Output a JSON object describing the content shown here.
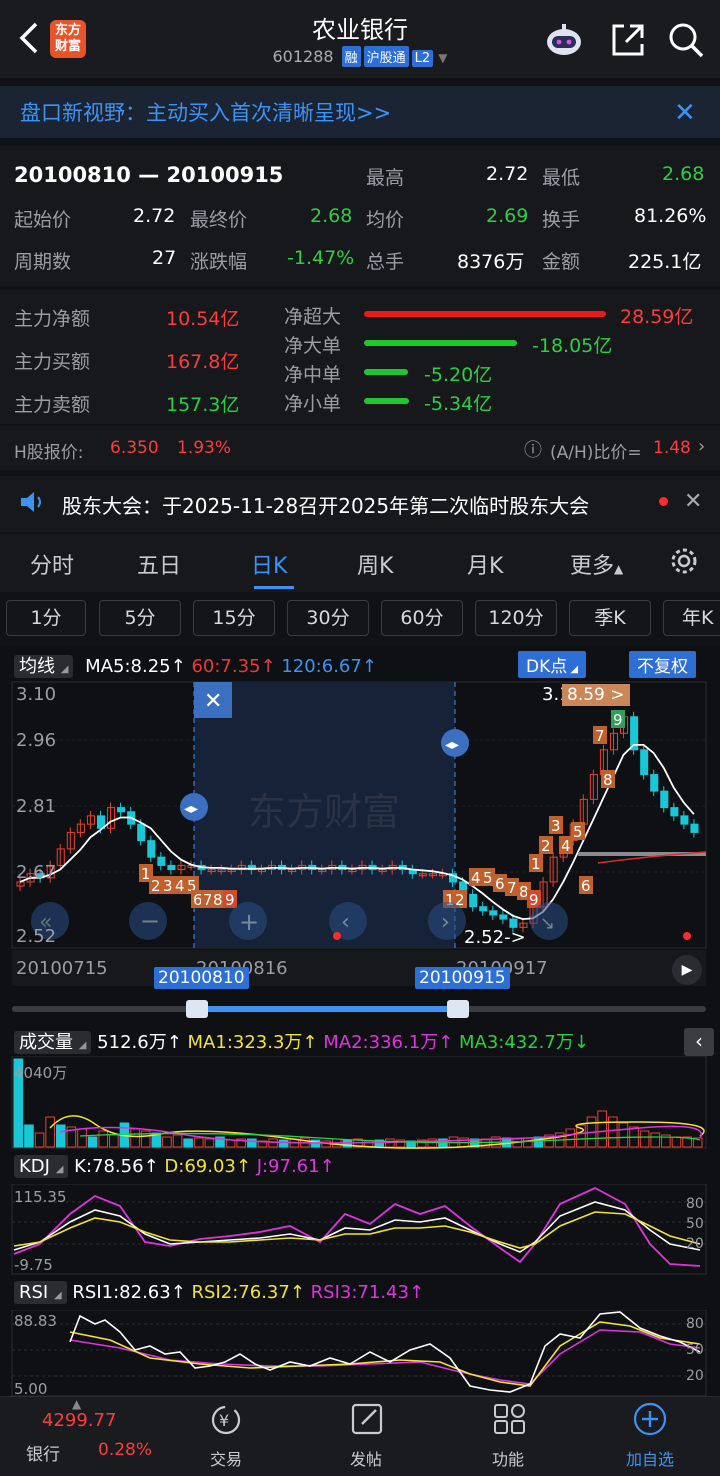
{
  "header": {
    "title": "农业银行",
    "code": "601288",
    "tags": [
      "融",
      "沪股通",
      "L2"
    ],
    "logo_text": "东方财富"
  },
  "banner": {
    "text": "盘口新视野：主动买入首次清晰呈现>>"
  },
  "range": {
    "label": "20100810 — 20100915",
    "rows": [
      [
        {
          "k": "最高",
          "v": "2.72",
          "c": "white"
        },
        {
          "k": "最低",
          "v": "2.68",
          "c": "green"
        }
      ],
      [
        {
          "k": "起始价",
          "v": "2.72",
          "c": "white"
        },
        {
          "k": "最终价",
          "v": "2.68",
          "c": "green"
        },
        {
          "k": "均价",
          "v": "2.69",
          "c": "green"
        },
        {
          "k": "换手",
          "v": "81.26%",
          "c": "white"
        }
      ],
      [
        {
          "k": "周期数",
          "v": "27",
          "c": "white"
        },
        {
          "k": "涨跌幅",
          "v": "-1.47%",
          "c": "green"
        },
        {
          "k": "总手",
          "v": "8376万",
          "c": "white"
        },
        {
          "k": "金额",
          "v": "225.1亿",
          "c": "white"
        }
      ]
    ]
  },
  "capital": {
    "net_label": "主力净额",
    "net_value": "10.54亿",
    "buy_label": "主力买额",
    "buy_value": "167.8亿",
    "sell_label": "主力卖额",
    "sell_value": "157.3亿",
    "flows": [
      {
        "label": "净超大",
        "value": "28.59亿",
        "amount": 28.59,
        "color": "#e81a1a"
      },
      {
        "label": "净大单",
        "value": "-18.05亿",
        "amount": -18.05,
        "color": "#1fc72f"
      },
      {
        "label": "净中单",
        "value": "-5.20亿",
        "amount": -5.2,
        "color": "#1fc72f"
      },
      {
        "label": "净小单",
        "value": "-5.34亿",
        "amount": -5.34,
        "color": "#1fc72f"
      }
    ]
  },
  "hshare": {
    "label": "H股报价:",
    "price": "6.350",
    "change": "1.93%",
    "ratio_label": "(A/H)比价=",
    "ratio_value": "1.48"
  },
  "notice": {
    "text": "股东大会：于2025-11-28召开2025年第二次临时股东大会"
  },
  "tabs": [
    "分时",
    "五日",
    "日K",
    "周K",
    "月K",
    "更多"
  ],
  "active_tab": "日K",
  "periods": [
    "1分",
    "5分",
    "15分",
    "30分",
    "60分",
    "120分",
    "季K",
    "年K"
  ],
  "kline": {
    "indicator": "均线",
    "ma5": "MA5:8.25",
    "ma60": "60:7.35",
    "ma120": "120:6.67",
    "dk_label": "DK点",
    "adjust_label": "不复权",
    "y_labels": [
      "3.10",
      "2.96",
      "2.81",
      "2.67",
      "2.52"
    ],
    "start_date": "20100715",
    "date_mid": "20100816",
    "date_right": "20100917",
    "sel_start": "20100810",
    "sel_end": "20100915",
    "low_marker": "2.52->",
    "high_label": "3.1",
    "high_tag": "8.59 >"
  },
  "volume": {
    "label": "成交量",
    "value": "512.6万",
    "ma1": "MA1:323.3万",
    "ma2": "MA2:336.1万",
    "ma3": "MA3:432.7万",
    "max_label": "4040万"
  },
  "kdj": {
    "label": "KDJ",
    "k": "K:78.56",
    "d": "D:69.03",
    "j": "J:97.61",
    "top": "115.35",
    "bottom": "-9.75",
    "ticks": [
      "80",
      "50",
      "20"
    ]
  },
  "rsi": {
    "label": "RSI",
    "r1": "RSI1:82.63",
    "r2": "RSI2:76.37",
    "r3": "RSI3:71.43",
    "top": "88.83",
    "bottom": "5.00",
    "ticks": [
      "80",
      "50",
      "20"
    ]
  },
  "nav": {
    "index_value": "4299.77",
    "index_name": "银行",
    "index_change": "0.28%",
    "items": [
      "交易",
      "发帖",
      "功能",
      "加自选"
    ]
  },
  "colors": {
    "up": "#e8412f",
    "down": "#18c8d8",
    "accent": "#3b93f5",
    "ma_white": "#ffffff",
    "ma_yellow": "#f4e23a",
    "ma_magenta": "#e033e0"
  }
}
